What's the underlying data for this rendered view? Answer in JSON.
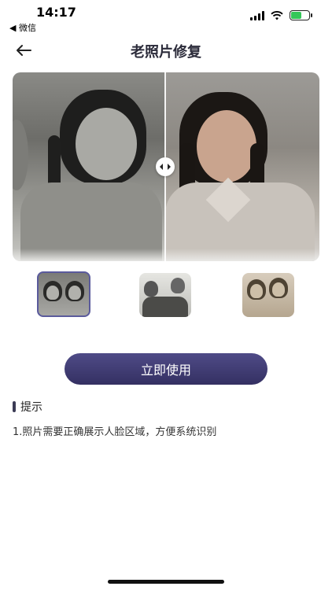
{
  "status_bar": {
    "time": "14:17",
    "back_app": "◀ 微信",
    "battery_color": "#34c759"
  },
  "nav": {
    "title": "老照片修复",
    "back_icon": "arrow-left-icon"
  },
  "compare": {
    "before_label": "",
    "after_label": "",
    "handle_icon": "left-right-arrows-icon"
  },
  "thumbnails": [
    {
      "name": "two-girls-photo",
      "selected": true
    },
    {
      "name": "two-men-photo",
      "selected": false
    },
    {
      "name": "couple-sepia-photo",
      "selected": false
    }
  ],
  "action": {
    "use_label": "立即使用",
    "accent": "#3f3b74"
  },
  "tips": {
    "title": "提示",
    "items": [
      "1.照片需要正确展示人脸区域，方便系统识别"
    ]
  }
}
